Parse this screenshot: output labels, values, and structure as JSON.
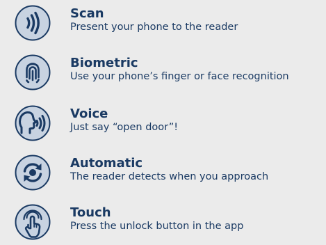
{
  "colors": {
    "background": "#ebebeb",
    "icon_fill": "#c8d3e1",
    "icon_ring": "#1a3a63",
    "text": "#1a3a63"
  },
  "methods": [
    {
      "icon": "nfc-waves-icon",
      "title": "Scan",
      "description": "Present your phone to the reader"
    },
    {
      "icon": "fingerprint-icon",
      "title": "Biometric",
      "description": "Use your phone’s finger or face recognition"
    },
    {
      "icon": "voice-head-icon",
      "title": "Voice",
      "description": "Just say “open door”!"
    },
    {
      "icon": "refresh-arrows-icon",
      "title": "Automatic",
      "description": "The reader detects when you approach"
    },
    {
      "icon": "touch-hand-icon",
      "title": "Touch",
      "description": "Press the unlock button in the app"
    }
  ]
}
